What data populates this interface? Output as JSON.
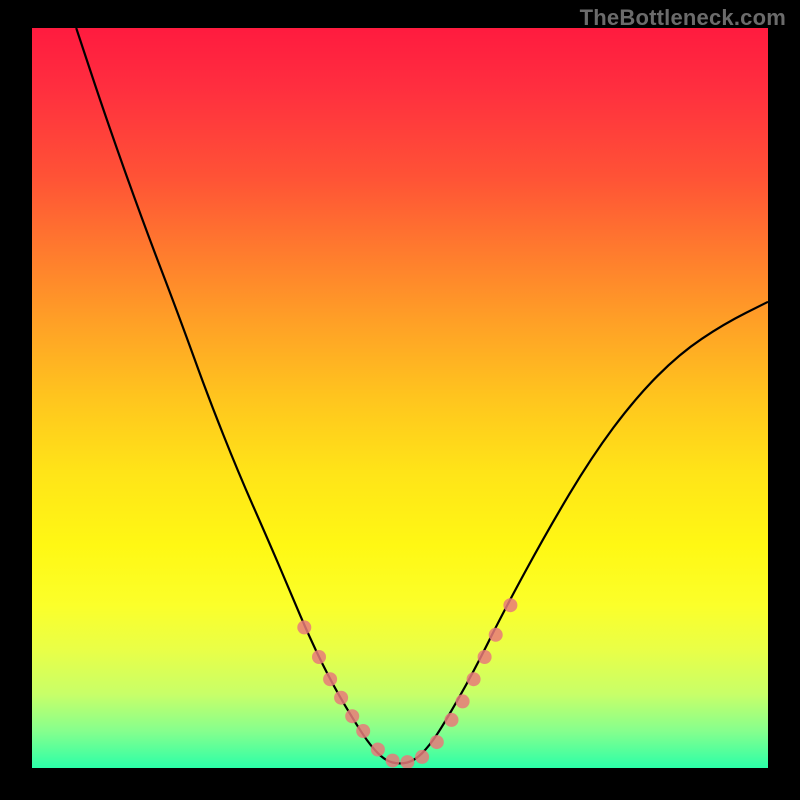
{
  "watermark": "TheBottleneck.com",
  "chart_data": {
    "type": "line",
    "title": "",
    "xlabel": "",
    "ylabel": "",
    "xlim": [
      0,
      100
    ],
    "ylim": [
      0,
      100
    ],
    "series": [
      {
        "name": "bottleneck-curve",
        "x": [
          6,
          10,
          15,
          20,
          24,
          28,
          32,
          35,
          38,
          41,
          44,
          46,
          48,
          50,
          52,
          54,
          56,
          60,
          64,
          70,
          76,
          82,
          88,
          94,
          100
        ],
        "y": [
          100,
          88,
          74,
          61,
          50,
          40,
          31,
          24,
          17,
          11,
          6,
          3,
          1,
          0.5,
          1,
          3,
          6,
          13,
          21,
          32,
          42,
          50,
          56,
          60,
          63
        ]
      }
    ],
    "markers": {
      "name": "sample-points",
      "x": [
        37,
        39,
        40.5,
        42,
        43.5,
        45,
        47,
        49,
        51,
        53,
        55,
        57,
        58.5,
        60,
        61.5,
        63,
        65
      ],
      "y": [
        19,
        15,
        12,
        9.5,
        7,
        5,
        2.5,
        1,
        0.8,
        1.5,
        3.5,
        6.5,
        9,
        12,
        15,
        18,
        22
      ]
    },
    "gradient_stops": [
      {
        "pos": 0,
        "color": "#ff1b3f"
      },
      {
        "pos": 50,
        "color": "#ffc51e"
      },
      {
        "pos": 80,
        "color": "#fbff2a"
      },
      {
        "pos": 100,
        "color": "#2bffa8"
      }
    ]
  }
}
